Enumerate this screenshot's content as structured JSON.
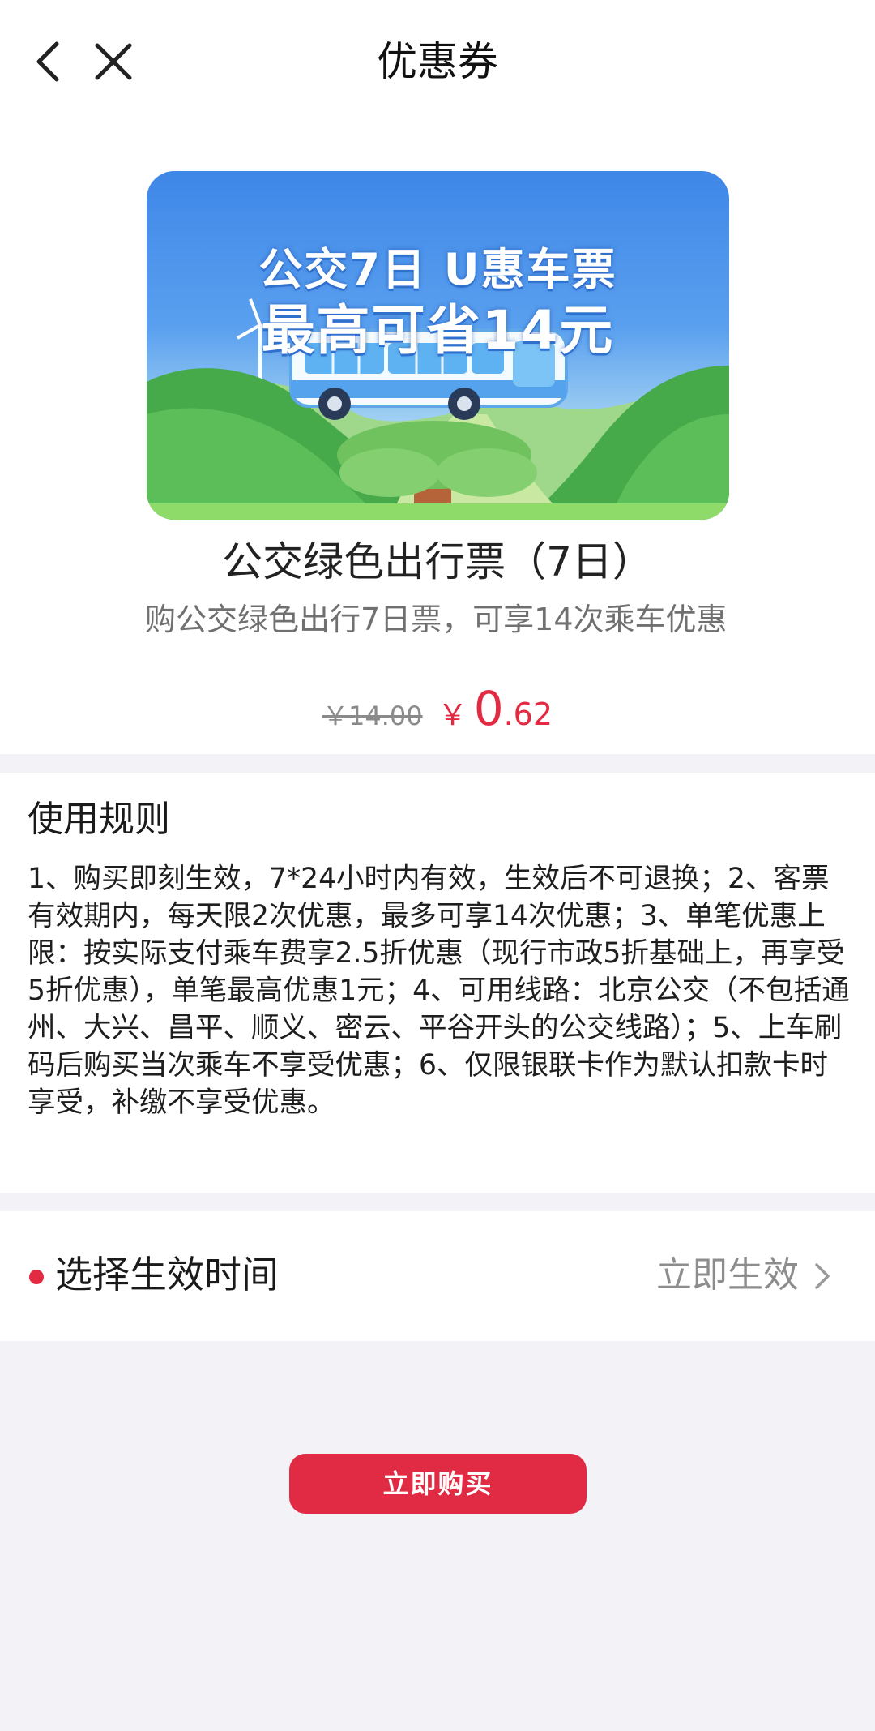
{
  "header": {
    "title": "优惠券",
    "back_icon": "chevron-left-icon",
    "close_icon": "close-icon"
  },
  "product": {
    "banner": {
      "line1": "公交7日 U惠车票",
      "line2": "最高可省14元"
    },
    "name": "公交绿色出行票（7日）",
    "description": "购公交绿色出行7日票，可享14次乘车优惠",
    "original_price": "￥14.00",
    "price_symbol": "￥",
    "price_integer": "0",
    "price_decimal": ".62"
  },
  "rules": {
    "title": "使用规则",
    "text": "1、购买即刻生效，7*24小时内有效，生效后不可退换；2、客票有效期内，每天限2次优惠，最多可享14次优惠；3、单笔优惠上限：按实际支付乘车费享2.5折优惠（现行市政5折基础上，再享受5折优惠），单笔最高优惠1元；4、可用线路：北京公交（不包括通州、大兴、昌平、顺义、密云、平谷开头的公交线路）；5、上车刷码后购买当次乘车不享受优惠；6、仅限银联卡作为默认扣款卡时享受，补缴不享受优惠。"
  },
  "effect_time": {
    "label": "选择生效时间",
    "value": "立即生效"
  },
  "buy_button": {
    "label": "立即购买"
  },
  "colors": {
    "accent": "#e22b42",
    "button": "#e12b44",
    "background": "#f2f2f7"
  }
}
